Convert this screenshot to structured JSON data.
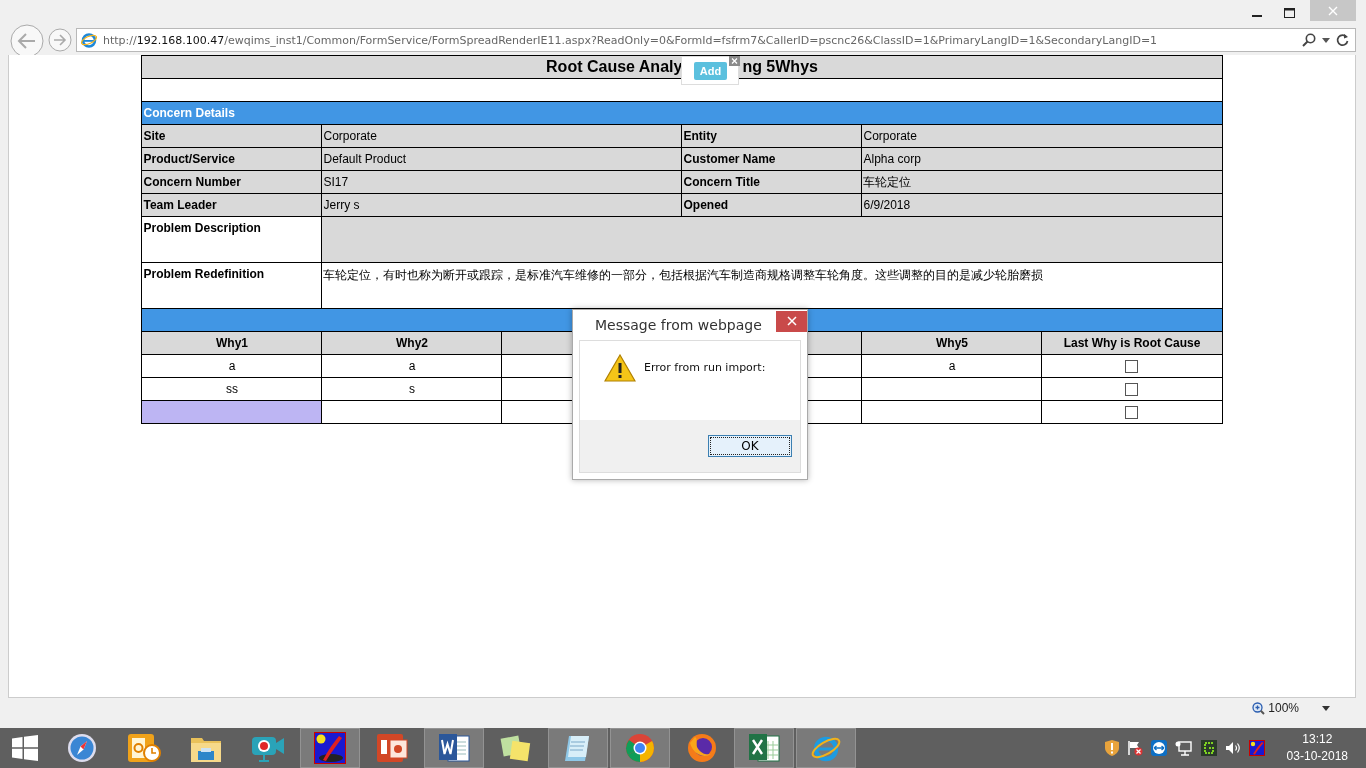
{
  "browser": {
    "url": {
      "scheme": "http://",
      "host": "192.168.100.47",
      "path": "/ewqims_inst1/Common/FormService/FormSpreadRenderIE11.aspx?ReadOnly=0&FormId=fsfrm7&CallerID=pscnc26&ClassID=1&PrimaryLangID=1&SecondaryLangID=1"
    },
    "zoom": "100%"
  },
  "form": {
    "title_parts": [
      "Root Cause Analy",
      "ng 5Whys"
    ],
    "add_popup": {
      "button": "Add"
    },
    "section": "Concern Details",
    "details": [
      {
        "label": "Site",
        "value": "Corporate",
        "label2": "Entity",
        "value2": "Corporate"
      },
      {
        "label": "Product/Service",
        "value": "Default Product",
        "label2": "Customer Name",
        "value2": "Alpha corp"
      },
      {
        "label": "Concern Number",
        "value": "SI17",
        "label2": "Concern Title",
        "value2": "车轮定位"
      },
      {
        "label": "Team Leader",
        "value": "Jerry s",
        "label2": "Opened",
        "value2": "6/9/2018"
      }
    ],
    "problem_description": {
      "label": "Problem Description"
    },
    "problem_redefinition": {
      "label": "Problem Redefinition",
      "value": "车轮定位，有时也称为断开或跟踪，是标准汽车维修的一部分，包括根据汽车制造商规格调整车轮角度。这些调整的目的是减少轮胎磨损"
    },
    "whys": {
      "headers_left": [
        "Why1",
        "Why2"
      ],
      "headers_right": [
        "Why5",
        "Last Why is Root Cause"
      ],
      "rows": [
        {
          "why1": "a",
          "why2": "a",
          "why5": "a",
          "root_cause": false,
          "selected": false
        },
        {
          "why1": "ss",
          "why2": "s",
          "root_cause": false,
          "selected": false
        },
        {
          "root_cause": false,
          "selected": true
        }
      ]
    }
  },
  "dialog": {
    "title": "Message from webpage",
    "message": "Error from run import:",
    "button": "OK"
  },
  "taskbar": {
    "apps": [
      {
        "kind": "compass",
        "running": false
      },
      {
        "kind": "mail",
        "running": false
      },
      {
        "kind": "folder",
        "running": false
      },
      {
        "kind": "camera",
        "running": false
      },
      {
        "kind": "paint",
        "running": true
      },
      {
        "kind": "slides",
        "running": false
      },
      {
        "kind": "word",
        "running": true
      },
      {
        "kind": "notes",
        "running": false
      },
      {
        "kind": "notepad",
        "running": true
      },
      {
        "kind": "chrome",
        "running": true
      },
      {
        "kind": "firefox",
        "running": false
      },
      {
        "kind": "excel",
        "running": true
      },
      {
        "kind": "ie",
        "running": true
      }
    ],
    "time": "13:12",
    "date": "03-10-2018"
  }
}
